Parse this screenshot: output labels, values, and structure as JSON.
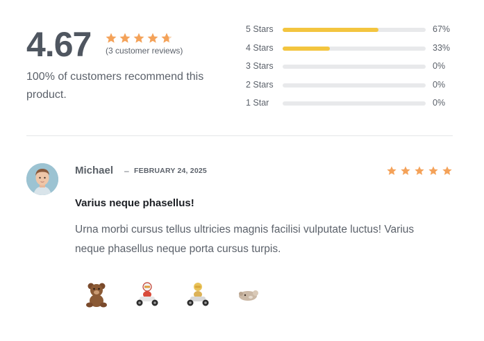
{
  "summary": {
    "average": "4.67",
    "average_value": 4.67,
    "max_rating": 5,
    "review_count": "(3 customer reviews)",
    "recommend_text": "100% of customers recommend this product."
  },
  "histogram": [
    {
      "label": "5 Stars",
      "percent": "67%",
      "fraction": 0.67
    },
    {
      "label": "4 Stars",
      "percent": "33%",
      "fraction": 0.33
    },
    {
      "label": "3 Stars",
      "percent": "0%",
      "fraction": 0
    },
    {
      "label": "2 Stars",
      "percent": "0%",
      "fraction": 0
    },
    {
      "label": "1 Star",
      "percent": "0%",
      "fraction": 0
    }
  ],
  "review": {
    "author": "Michael",
    "separator": "–",
    "date": "FEBRUARY 24, 2025",
    "rating": 5,
    "title": "Varius neque phasellus!",
    "body": "Urna morbi cursus tellus ultricies magnis facilisi vulputate luctus! Varius neque phasellus neque porta cursus turpis.",
    "images": [
      "teddy-bear",
      "go-kart-racer-red",
      "go-kart-racer-yellow",
      "plush-toy"
    ]
  },
  "colors": {
    "star": "#f4a259",
    "bar_fill": "#f3c53f",
    "bar_track": "#e8e9eb"
  }
}
